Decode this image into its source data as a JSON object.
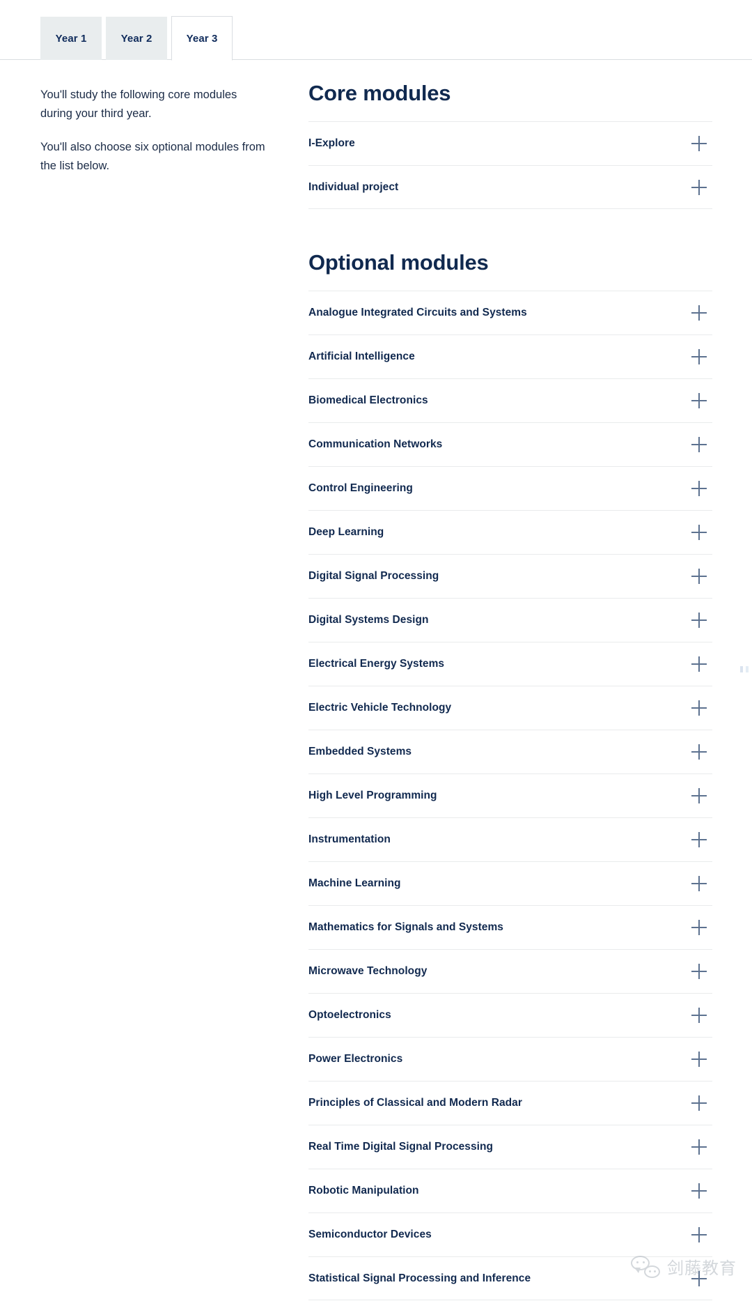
{
  "tabs": [
    {
      "label": "Year 1",
      "active": false
    },
    {
      "label": "Year 2",
      "active": false
    },
    {
      "label": "Year 3",
      "active": true
    }
  ],
  "intro": {
    "paragraph_1": "You'll study the following core modules during your third year.",
    "paragraph_2": "You'll also choose six optional modules from the list below."
  },
  "core": {
    "heading": "Core modules",
    "modules": [
      "I-Explore",
      "Individual project"
    ]
  },
  "optional": {
    "heading": "Optional modules",
    "modules": [
      "Analogue Integrated Circuits and Systems",
      "Artificial Intelligence",
      "Biomedical Electronics",
      "Communication Networks",
      "Control Engineering",
      "Deep Learning",
      "Digital Signal Processing",
      "Digital Systems Design",
      "Electrical Energy Systems",
      "Electric Vehicle Technology",
      "Embedded Systems",
      "High Level Programming",
      "Instrumentation",
      "Machine Learning",
      "Mathematics for Signals and Systems",
      "Microwave Technology",
      "Optoelectronics",
      "Power Electronics",
      "Principles of Classical and Modern Radar",
      "Real Time Digital Signal Processing",
      "Robotic Manipulation",
      "Semiconductor Devices",
      "Statistical Signal Processing and Inference"
    ]
  },
  "watermark": {
    "text": "剑藤教育"
  },
  "colors": {
    "heading": "#10294f",
    "module_title": "#11294f",
    "tab_inactive_bg": "#e9edee",
    "divider": "#e9ebec",
    "plus_icon": "#5d7290"
  },
  "icons": {
    "expand": "plus-icon",
    "watermark": "wechat-icon"
  }
}
